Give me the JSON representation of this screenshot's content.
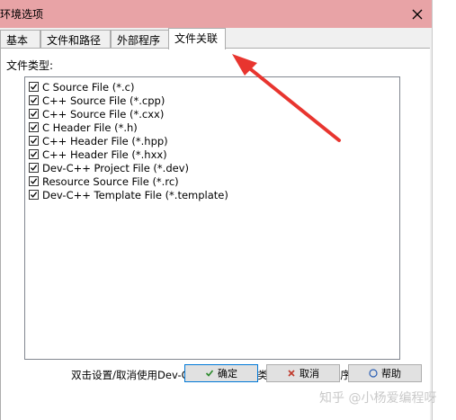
{
  "window": {
    "title": "环境选项",
    "close_icon": "close-icon"
  },
  "tabs": [
    {
      "label": "基本",
      "active": false
    },
    {
      "label": "文件和路径",
      "active": false
    },
    {
      "label": "外部程序",
      "active": false
    },
    {
      "label": "文件关联",
      "active": true
    }
  ],
  "panel": {
    "file_types_label": "文件类型:",
    "file_types": [
      {
        "label": "C Source File  (*.c)",
        "checked": true
      },
      {
        "label": "C++ Source File  (*.cpp)",
        "checked": true
      },
      {
        "label": "C++ Source File  (*.cxx)",
        "checked": true
      },
      {
        "label": "C Header File  (*.h)",
        "checked": true
      },
      {
        "label": "C++ Header File  (*.hpp)",
        "checked": true
      },
      {
        "label": "C++ Header File  (*.hxx)",
        "checked": true
      },
      {
        "label": "Dev-C++ Project File  (*.dev)",
        "checked": true
      },
      {
        "label": "Resource Source File  (*.rc)",
        "checked": true
      },
      {
        "label": "Dev-C++ Template File  (*.template)",
        "checked": true
      }
    ],
    "hint": "双击设置/取消使用Dev-C++做为该文件类型的默认编辑程序..."
  },
  "buttons": {
    "ok_label": "确定",
    "cancel_label": "取消",
    "help_label": "帮助"
  },
  "watermark": "知乎 @小杨爱编程呀",
  "colors": {
    "titlebar": "#e8a3a6",
    "annotation_arrow": "#e8352f"
  }
}
